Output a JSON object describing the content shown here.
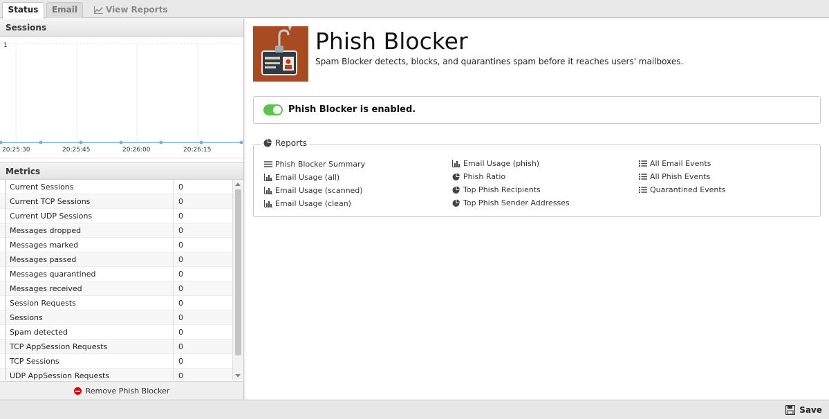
{
  "tabs": [
    {
      "label": "Status",
      "active": true
    },
    {
      "label": "Email",
      "active": false
    },
    {
      "label": "View Reports",
      "active": false,
      "icon": "line-chart-icon"
    }
  ],
  "sessions": {
    "title": "Sessions",
    "y_tick": "1",
    "x_ticks": [
      "20:25:30",
      "20:25:45",
      "20:26:00",
      "20:26:15"
    ]
  },
  "chart_data": {
    "type": "line",
    "x": [
      "20:25:30",
      "20:25:45",
      "20:26:00",
      "20:26:15"
    ],
    "series": [
      {
        "values": [
          0,
          0,
          0,
          0,
          0,
          0,
          0
        ]
      }
    ],
    "ylim": [
      0,
      1
    ],
    "grid": true
  },
  "metrics": {
    "title": "Metrics",
    "rows": [
      {
        "name": "Current Sessions",
        "value": "0"
      },
      {
        "name": "Current TCP Sessions",
        "value": "0"
      },
      {
        "name": "Current UDP Sessions",
        "value": "0"
      },
      {
        "name": "Messages dropped",
        "value": "0"
      },
      {
        "name": "Messages marked",
        "value": "0"
      },
      {
        "name": "Messages passed",
        "value": "0"
      },
      {
        "name": "Messages quarantined",
        "value": "0"
      },
      {
        "name": "Messages received",
        "value": "0"
      },
      {
        "name": "Session Requests",
        "value": "0"
      },
      {
        "name": "Sessions",
        "value": "0"
      },
      {
        "name": "Spam detected",
        "value": "0"
      },
      {
        "name": "TCP AppSession Requests",
        "value": "0"
      },
      {
        "name": "TCP Sessions",
        "value": "0"
      },
      {
        "name": "UDP AppSession Requests",
        "value": "0"
      }
    ]
  },
  "remove_label": "Remove Phish Blocker",
  "app": {
    "title": "Phish Blocker",
    "description": "Spam Blocker detects, blocks, and quarantines spam before it reaches users' mailboxes.",
    "status_text": "Phish Blocker is enabled.",
    "enabled": true
  },
  "reports": {
    "title": "Reports",
    "col1": [
      {
        "label": "Phish Blocker Summary",
        "icon": "list-lines-icon"
      },
      {
        "label": "Email Usage (all)",
        "icon": "bar-chart-icon"
      },
      {
        "label": "Email Usage (scanned)",
        "icon": "bar-chart-icon"
      },
      {
        "label": "Email Usage (clean)",
        "icon": "bar-chart-icon"
      }
    ],
    "col2": [
      {
        "label": "Email Usage (phish)",
        "icon": "bar-chart-icon"
      },
      {
        "label": "Phish Ratio",
        "icon": "pie-chart-icon"
      },
      {
        "label": "Top Phish Recipients",
        "icon": "pie-chart-icon"
      },
      {
        "label": "Top Phish Sender Addresses",
        "icon": "pie-chart-icon"
      }
    ],
    "col3": [
      {
        "label": "All Email Events",
        "icon": "list-bullets-icon"
      },
      {
        "label": "All Phish Events",
        "icon": "list-bullets-icon"
      },
      {
        "label": "Quarantined Events",
        "icon": "list-bullets-icon"
      }
    ]
  },
  "footer": {
    "save_label": "Save"
  },
  "colors": {
    "accent_green": "#5cc24c",
    "icon_brown": "#a84a22",
    "remove_red": "#d40000",
    "chart_line": "#7aaedc"
  }
}
